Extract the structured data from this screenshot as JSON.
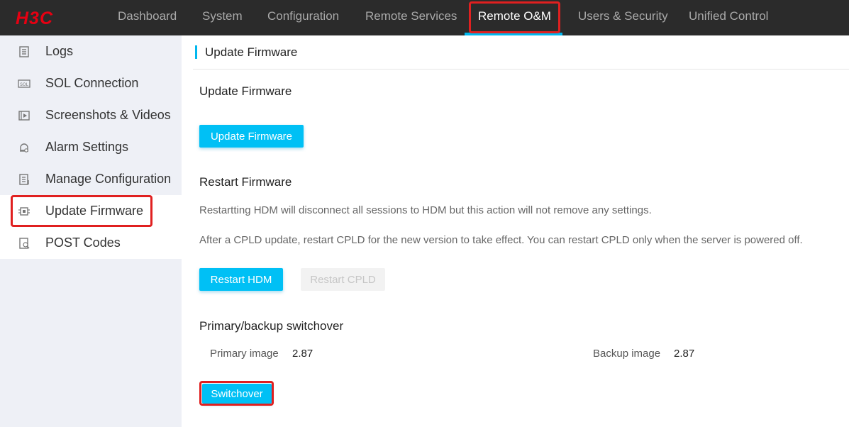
{
  "brand": {
    "logo_text": "H3C",
    "logo_color": "#e60012",
    "accent": "#00b7ee",
    "highlight_color": "#e02020"
  },
  "nav": {
    "items": [
      {
        "label": "Dashboard"
      },
      {
        "label": "System"
      },
      {
        "label": "Configuration"
      },
      {
        "label": "Remote Services"
      },
      {
        "label": "Remote O&M",
        "active": true
      },
      {
        "label": "Users & Security"
      },
      {
        "label": "Unified Control"
      }
    ]
  },
  "sidebar": {
    "items": [
      {
        "label": "Logs",
        "icon": "log-icon"
      },
      {
        "label": "SOL Connection",
        "icon": "sol-icon"
      },
      {
        "label": "Screenshots & Videos",
        "icon": "video-icon"
      },
      {
        "label": "Alarm Settings",
        "icon": "alarm-bell-icon"
      },
      {
        "label": "Manage Configuration",
        "icon": "config-file-icon"
      },
      {
        "label": "Update Firmware",
        "icon": "chip-icon",
        "active": true
      },
      {
        "label": "POST Codes",
        "icon": "post-codes-icon"
      }
    ]
  },
  "main": {
    "header_title": "Update Firmware",
    "update": {
      "title": "Update Firmware",
      "button_label": "Update Firmware"
    },
    "restart": {
      "title": "Restart Firmware",
      "desc1": "Restartting HDM will disconnect all sessions to HDM but this action will not remove any settings.",
      "desc2": "After a CPLD update, restart CPLD for the new version to take effect. You can restart CPLD only when the server is powered off.",
      "restart_hdm_label": "Restart HDM",
      "restart_cpld_label": "Restart CPLD"
    },
    "switchover": {
      "title": "Primary/backup switchover",
      "primary_label": "Primary image",
      "primary_value": "2.87",
      "backup_label": "Backup image",
      "backup_value": "2.87",
      "button_label": "Switchover"
    }
  }
}
